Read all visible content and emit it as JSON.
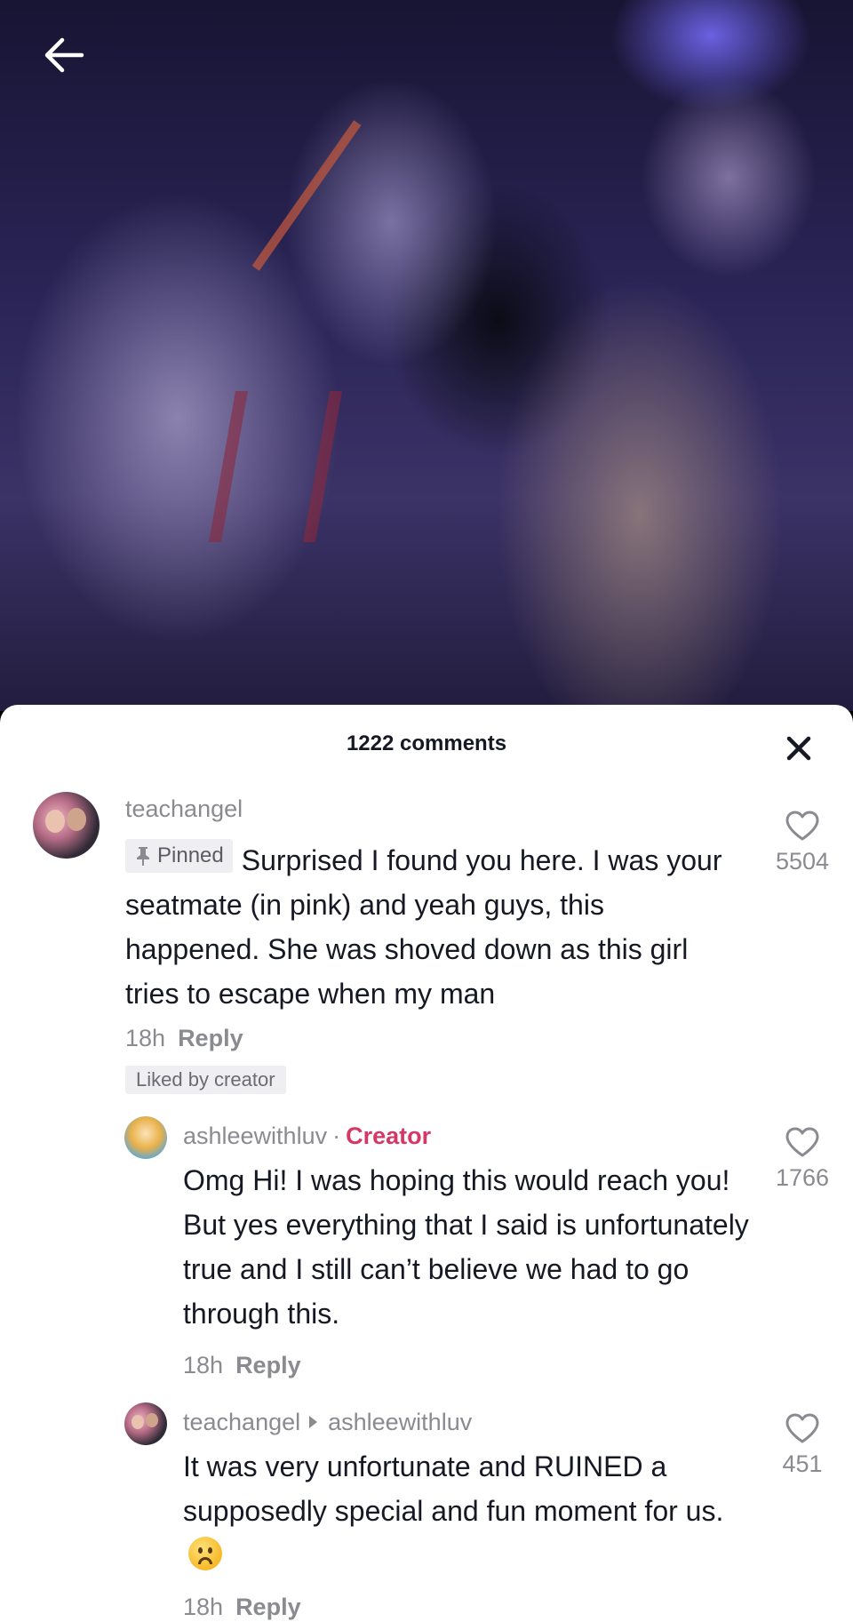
{
  "header": {
    "back_icon": "arrow-left-icon"
  },
  "sheet": {
    "comments_count": "1222 comments",
    "close_icon": "close-icon"
  },
  "comments": [
    {
      "username": "teachangel",
      "pinned_label": "Pinned",
      "text": "Surprised I found you here. I was your seatmate (in pink) and yeah guys, this happened. She was shoved down as this girl tries to escape when my man",
      "time": "18h",
      "reply_label": "Reply",
      "liked_by_creator": "Liked by creator",
      "likes": "5504"
    },
    {
      "username": "ashleewithluv",
      "creator_label": "Creator",
      "text": "Omg Hi! I was hoping this would reach you! But yes everything that I said is unfortunately true and I still can’t believe we had to go through this.",
      "time": "18h",
      "reply_label": "Reply",
      "likes": "1766"
    },
    {
      "username": "teachangel",
      "reply_to": "ashleewithluv",
      "text": "It was very unfortunate and RUINED a supposedly special and fun moment for us.",
      "time": "18h",
      "reply_label": "Reply",
      "likes": "451"
    }
  ],
  "colors": {
    "creator_accent": "#d63866",
    "secondary_text": "#8a8b91",
    "primary_text": "#161823"
  }
}
